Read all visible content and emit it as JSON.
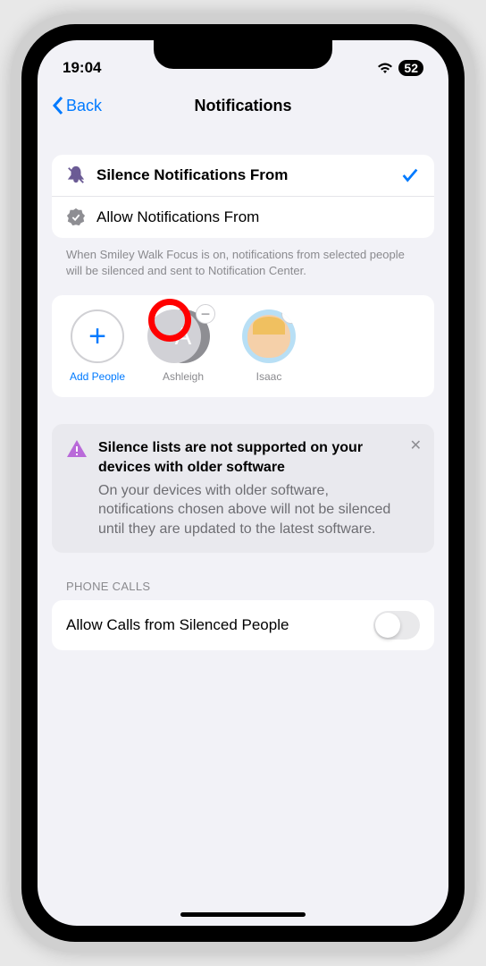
{
  "status": {
    "time": "19:04",
    "battery": "52"
  },
  "nav": {
    "back": "Back",
    "title": "Notifications"
  },
  "options": {
    "silence": "Silence Notifications From",
    "allow": "Allow Notifications From"
  },
  "description": "When Smiley Walk Focus is on, notifications from selected people will be silenced and sent to Notification Center.",
  "people": {
    "add": "Add People",
    "items": [
      {
        "name": "Ashleigh",
        "initial": "A"
      },
      {
        "name": "Isaac"
      }
    ]
  },
  "alert": {
    "title": "Silence lists are not supported on your devices with older software",
    "body": "On your devices with older software, notifications chosen above will not be silenced until they are updated to the latest software."
  },
  "phone_calls": {
    "header": "PHONE CALLS",
    "allow": "Allow Calls from Silenced People"
  }
}
